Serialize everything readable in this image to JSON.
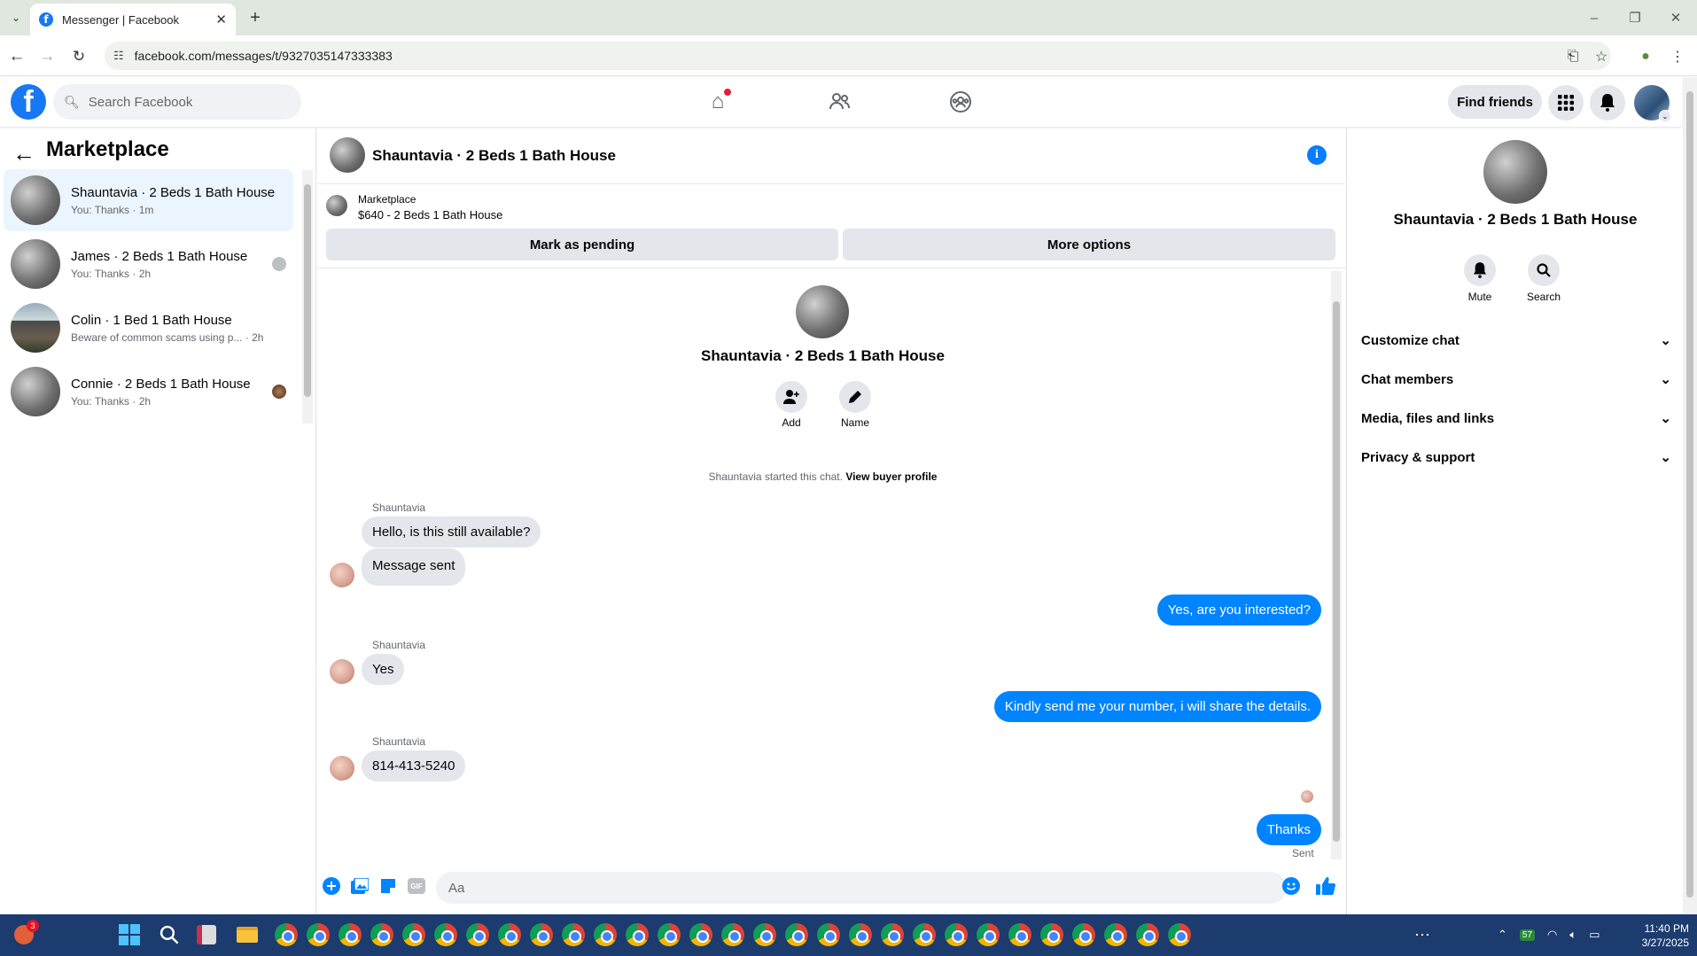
{
  "browser": {
    "tab_title": "Messenger | Facebook",
    "url": "facebook.com/messages/t/9327035147333383",
    "new_tab": "+",
    "close_tab": "✕"
  },
  "fb": {
    "logo": "f",
    "search_placeholder": "Search Facebook",
    "find_friends": "Find friends"
  },
  "left": {
    "title": "Marketplace",
    "conversations": [
      {
        "name": "Shauntavia · 2 Beds 1 Bath House",
        "sub": "You: Thanks · 1m",
        "active": true
      },
      {
        "name": "James · 2 Beds 1 Bath House",
        "sub": "You: Thanks · 2h",
        "active": false
      },
      {
        "name": "Colin · 1 Bed 1 Bath House",
        "sub": "Beware of common scams using p...  · 2h",
        "active": false
      },
      {
        "name": "Connie · 2 Beds 1 Bath House",
        "sub": "You: Thanks · 2h",
        "active": false
      }
    ]
  },
  "chat": {
    "title": "Shauntavia · 2 Beds 1 Bath House",
    "marketplace_label": "Marketplace",
    "listing": "$640 - 2 Beds 1 Bath House",
    "mark_pending": "Mark as pending",
    "more_options": "More options",
    "profile_name": "Shauntavia · 2 Beds 1 Bath House",
    "add_label": "Add",
    "name_label": "Name",
    "started_text": "Shauntavia started this chat.",
    "view_buyer": "View buyer profile",
    "messages": [
      {
        "sender": "Shauntavia",
        "text": "Hello, is this still available?"
      },
      {
        "text": "Message sent"
      },
      {
        "text": "Yes, are you interested?"
      },
      {
        "sender": "Shauntavia",
        "text": "Yes"
      },
      {
        "text": "Kindly send me your number, i will share the details."
      },
      {
        "sender": "Shauntavia",
        "text": "814-413-5240"
      },
      {
        "text": "Thanks"
      }
    ],
    "sent_status": "Sent",
    "input_placeholder": "Aa"
  },
  "right": {
    "name": "Shauntavia · 2 Beds 1 Bath House",
    "mute": "Mute",
    "search": "Search",
    "sections": [
      "Customize chat",
      "Chat members",
      "Media, files and links",
      "Privacy & support"
    ]
  },
  "taskbar": {
    "weather": "57",
    "time": "11:40 PM",
    "date": "3/27/2025",
    "badge": "3"
  },
  "colors": {
    "accent": "#0084ff",
    "brand": "#1877f2"
  }
}
